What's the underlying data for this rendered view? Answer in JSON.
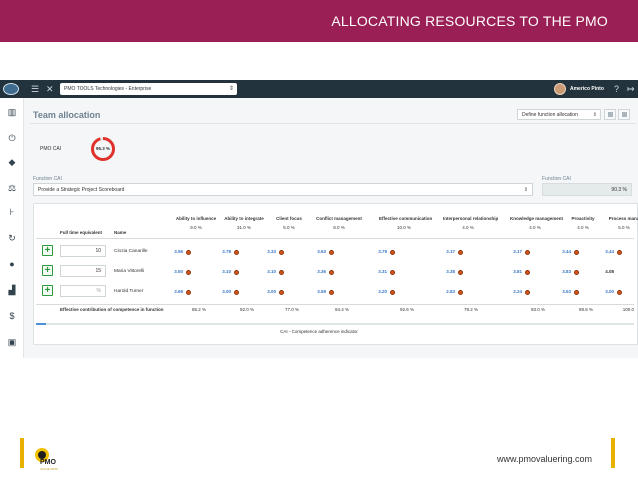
{
  "slide": {
    "title": "ALLOCATING RESOURCES TO THE PMO",
    "banner_color": "#9a1f55",
    "accent_color": "#e8b000"
  },
  "topbar": {
    "company_select": "PMO TOOLS Technologies - Enterprise",
    "user_name": "Americo Pinto"
  },
  "page": {
    "title": "Team allocation",
    "define_select": "Define function allocation"
  },
  "pmo_cai": {
    "label": "PMO CAI",
    "value": "95.3 %",
    "fraction": 0.953
  },
  "function_cai": {
    "label": "Function CAI",
    "right_label": "Function CAI",
    "scorecard": "Provide a Strategic Project Scoreboard",
    "value": "90.3 %"
  },
  "table": {
    "fte_header": "Full time equivalent",
    "name_header": "Name",
    "columns": [
      {
        "name": "Ability to influence",
        "weight": "9.0 %"
      },
      {
        "name": "Ability to integrate",
        "weight": "31.0 %"
      },
      {
        "name": "Client focus",
        "weight": "5.0 %"
      },
      {
        "name": "Conflict management",
        "weight": "8.0 %"
      },
      {
        "name": "Effective communication",
        "weight": "10.0 %"
      },
      {
        "name": "Interpersonal relationship",
        "weight": "4.0 %"
      },
      {
        "name": "Knowledge management",
        "weight": "4.0 %"
      },
      {
        "name": "Proactivity",
        "weight": "4.0 %"
      },
      {
        "name": "Process mana",
        "weight": "5.0 %"
      }
    ],
    "rows": [
      {
        "fte": "10",
        "name": "Cinzia Canarille",
        "scores": [
          "3.56",
          "3.78",
          "3.33",
          "3.63",
          "3.79",
          "3.17",
          "3.17",
          "3.44",
          "3.44"
        ]
      },
      {
        "fte": "15",
        "name": "Maria Vittorelli",
        "scores": [
          "3.50",
          "3.10",
          "3.10",
          "3.36",
          "3.31",
          "3.38",
          "3.81",
          "3.83",
          "4.08"
        ]
      },
      {
        "fte": "",
        "fte_placeholder": "%",
        "name": "Harold Turner",
        "scores": [
          "3.69",
          "3.00",
          "3.00",
          "3.59",
          "3.20",
          "2.83",
          "2.24",
          "3.53",
          "3.00"
        ]
      }
    ],
    "contribution": {
      "label": "Effective contribution of competence in function",
      "values": [
        "85.2 %",
        "92.0 %",
        "77.0 %",
        "94.4 %",
        "92.6 %",
        "79.2 %",
        "93.0 %",
        "89.6 %",
        "100.0"
      ]
    },
    "caption": "CAI - Competence adherence indicator"
  },
  "footer": {
    "logo_text": "PMO",
    "logo_sub": "VALUE RING",
    "url": "www.pmovaluering.com"
  }
}
